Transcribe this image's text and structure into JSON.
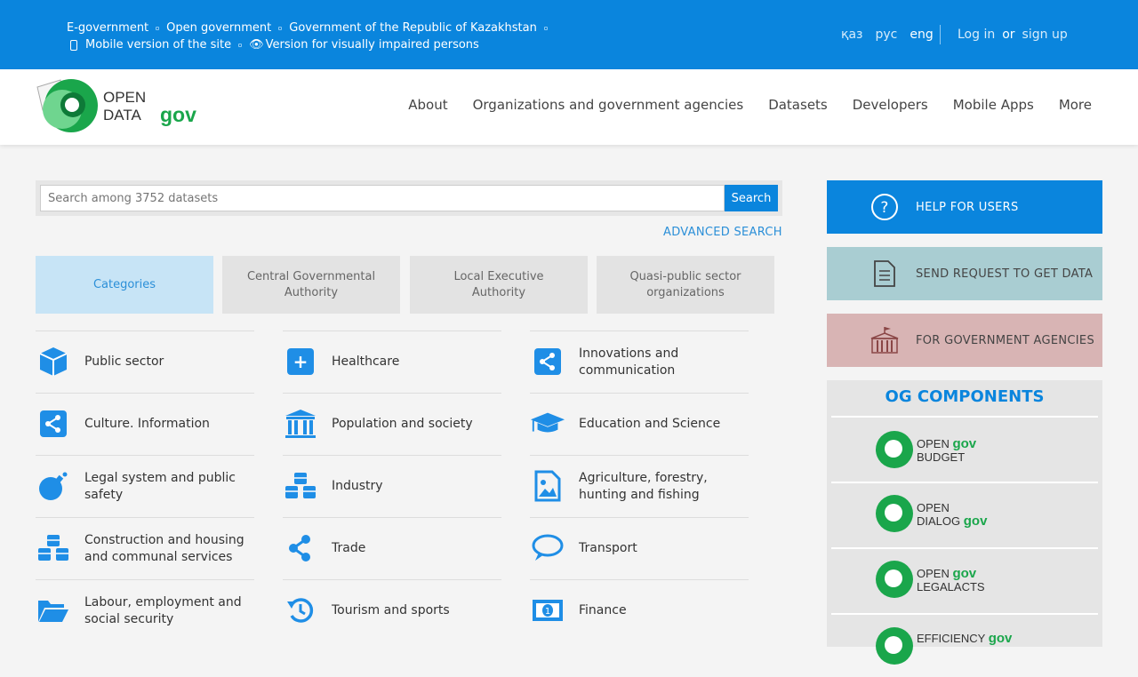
{
  "topbar": {
    "links_row1": [
      "E-government",
      "Open government",
      "Government of the Republic of Kazakhstan"
    ],
    "mobile_link": "Mobile version of the site",
    "impaired_link": "Version for visually impaired persons",
    "langs": [
      "қаз",
      "рус",
      "eng"
    ],
    "login": "Log in",
    "or": "or",
    "signup": "sign up"
  },
  "logo": {
    "line1": "OPEN",
    "line2": "DATA",
    "gov": "gov"
  },
  "nav": [
    "About",
    "Organizations and government agencies",
    "Datasets",
    "Developers",
    "Mobile Apps",
    "More"
  ],
  "search": {
    "placeholder": "Search among 3752 datasets",
    "button": "Search",
    "advanced": "ADVANCED SEARCH"
  },
  "tabs": [
    "Categories",
    "Central Governmental Authority",
    "Local Executive Authority",
    "Quasi-public sector organizations"
  ],
  "categories": [
    [
      "Public sector",
      "Healthcare",
      "Innovations and communication"
    ],
    [
      "Culture. Information",
      "Population and society",
      "Education and Science"
    ],
    [
      "Legal system and public safety",
      "Industry",
      "Agriculture, forestry, hunting and fishing"
    ],
    [
      "Construction and housing and communal services",
      "Trade",
      "Transport"
    ],
    [
      "Labour, employment and social security",
      "Tourism and sports",
      "Finance"
    ]
  ],
  "side": {
    "help": "HELP FOR USERS",
    "request": "SEND REQUEST TO GET DATA",
    "gov_agencies": "FOR GOVERNMENT AGENCIES"
  },
  "og_components": {
    "title": "OG COMPONENTS",
    "items": [
      {
        "line1": "OPEN",
        "gov": "gov",
        "line2": "BUDGET"
      },
      {
        "line1": "OPEN",
        "gov": "gov",
        "line2": "DIALOG"
      },
      {
        "line1": "OPEN",
        "gov": "gov",
        "line2": "LEGALACTS"
      },
      {
        "line1": "EFFICIENCY",
        "gov": "gov",
        "line2": ""
      }
    ]
  },
  "colors": {
    "primary": "#0a85dd",
    "brand_green": "#1aa64b",
    "icon_blue": "#1f8ee6"
  }
}
